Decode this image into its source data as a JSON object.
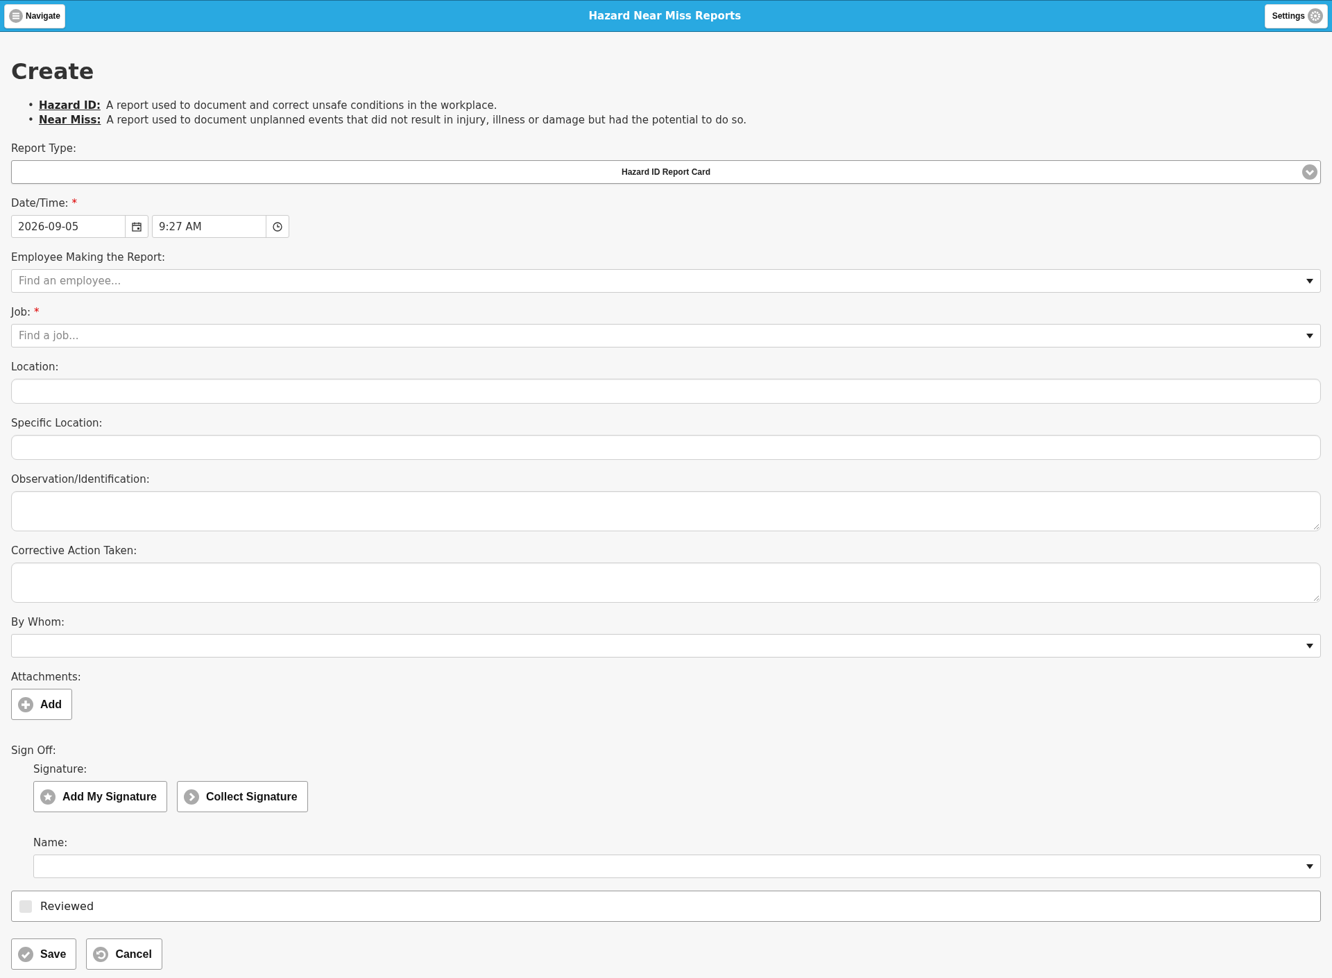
{
  "header": {
    "nav_button": "Navigate",
    "title": "Hazard Near Miss Reports",
    "settings_button": "Settings"
  },
  "page_title": "Create",
  "definitions": [
    {
      "bullet": "•",
      "term": "Hazard ID:",
      "text": "A report used to document and correct unsafe conditions in the workplace."
    },
    {
      "bullet": "•",
      "term": "Near Miss:",
      "text": "A report used to document unplanned events that did not result in injury, illness or damage but had the potential to do so."
    }
  ],
  "fields": [
    {
      "kind": "dropdown",
      "label": "Report Type:",
      "value": "Hazard ID Report Card"
    },
    {
      "kind": "datetime",
      "label": "Date/Time:",
      "marker": "*",
      "date": "2026-09-05",
      "time": "9:27 AM"
    },
    {
      "kind": "combo",
      "label": "Employee Making the Report:",
      "placeholder": "Find an employee..."
    },
    {
      "kind": "combo",
      "label": "Job:",
      "marker": "*",
      "placeholder": "Find a job..."
    },
    {
      "kind": "text",
      "label": "Location:"
    },
    {
      "kind": "text",
      "label": "Specific Location:"
    },
    {
      "kind": "textarea",
      "label": "Observation/Identification:"
    },
    {
      "kind": "textarea",
      "label": "Corrective Action Taken:"
    },
    {
      "kind": "combo",
      "label": "By Whom:"
    },
    {
      "kind": "attachments",
      "label": "Attachments:",
      "button": "Add"
    }
  ],
  "sign_off": {
    "label": "Sign Off:",
    "signature_label": "Signature:",
    "buttons": [
      {
        "label": "Add My Signature"
      },
      {
        "label": "Collect Signature"
      }
    ],
    "name_label": "Name:"
  },
  "reviewed": {
    "label": "Reviewed",
    "checked": false
  },
  "actions": [
    {
      "label": "Save"
    },
    {
      "label": "Cancel"
    }
  ]
}
